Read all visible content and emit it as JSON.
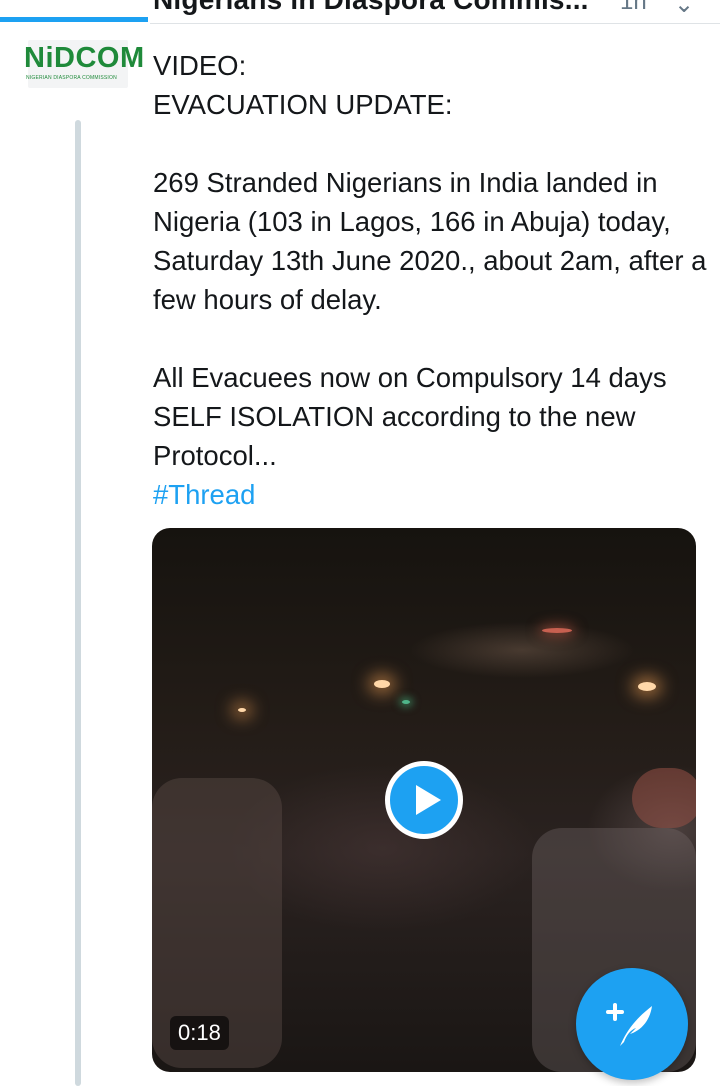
{
  "header": {
    "author_name": "Nigerians in Diaspora Commis...",
    "timestamp": "1h"
  },
  "avatar": {
    "logo_text": "NiDCOM",
    "logo_subtext": "NIGERIAN DIASPORA COMMISSION"
  },
  "tweet": {
    "line1": "VIDEO:",
    "line2": "EVACUATION UPDATE:",
    "paragraph2": "269 Stranded Nigerians in India landed in Nigeria (103 in Lagos, 166 in Abuja) today, Saturday 13th June 2020., about 2am, after a few hours of delay.",
    "paragraph3": "All Evacuees now on Compulsory 14 days SELF ISOLATION according to the new Protocol...",
    "hashtag": "#Thread"
  },
  "video": {
    "duration": "0:18"
  },
  "colors": {
    "accent": "#1da1f2",
    "text": "#14171a",
    "brand_green": "#1f8a3a"
  },
  "icons": {
    "play": "play-icon",
    "compose": "compose-tweet-icon",
    "more": "chevron-down-icon"
  }
}
